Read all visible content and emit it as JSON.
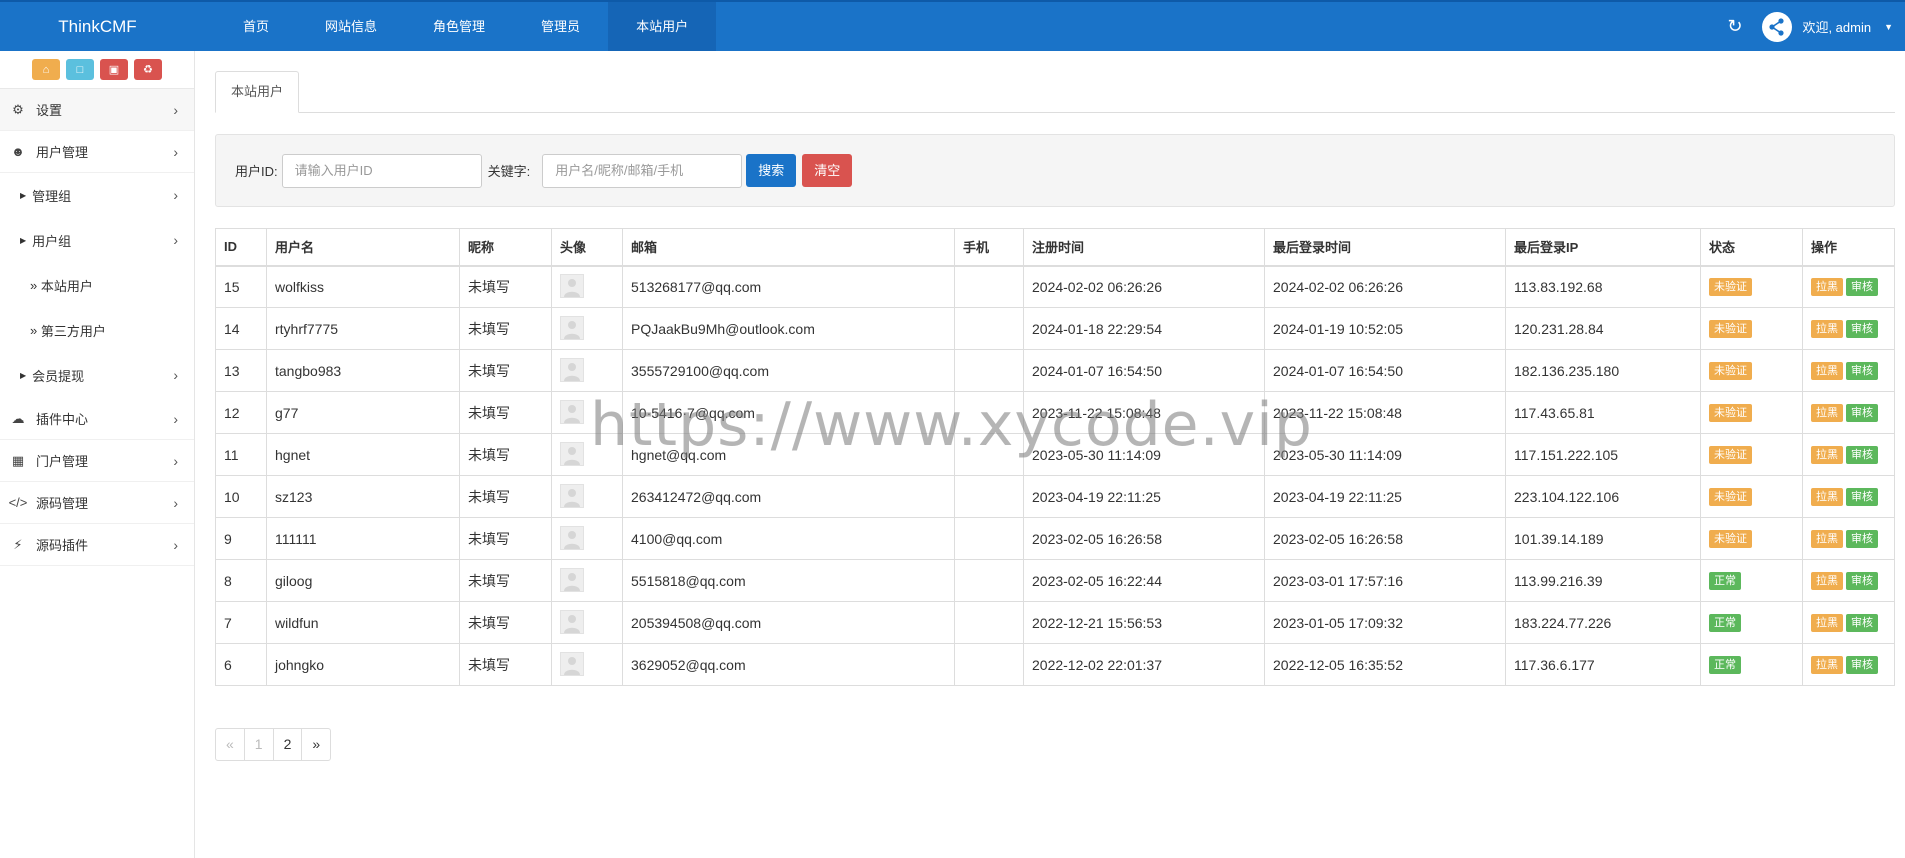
{
  "brand": "ThinkCMF",
  "nav": [
    "首页",
    "网站信息",
    "角色管理",
    "管理员",
    "本站用户"
  ],
  "user": {
    "welcome": "欢迎, admin"
  },
  "sidebar": {
    "items": [
      {
        "label": "设置"
      },
      {
        "label": "用户管理"
      },
      {
        "label": "管理组"
      },
      {
        "label": "用户组"
      },
      {
        "label": "本站用户"
      },
      {
        "label": "第三方用户"
      },
      {
        "label": "会员提现"
      },
      {
        "label": "插件中心"
      },
      {
        "label": "门户管理"
      },
      {
        "label": "源码管理"
      },
      {
        "label": "源码插件"
      }
    ]
  },
  "tab": "本站用户",
  "filter": {
    "uid_label": "用户ID:",
    "uid_placeholder": "请输入用户ID",
    "kw_label": "关键字:",
    "kw_placeholder": "用户名/昵称/邮箱/手机",
    "search": "搜索",
    "clear": "清空"
  },
  "table": {
    "headers": [
      "ID",
      "用户名",
      "昵称",
      "头像",
      "邮箱",
      "手机",
      "注册时间",
      "最后登录时间",
      "最后登录IP",
      "状态",
      "操作"
    ],
    "rows": [
      [
        "15",
        "wolfkiss",
        "未填写",
        "513268177@qq.com",
        "",
        "2024-02-02 06:26:26",
        "2024-02-02 06:26:26",
        "113.83.192.68",
        "未验证"
      ],
      [
        "14",
        "rtyhrf7775",
        "未填写",
        "PQJaakBu9Mh@outlook.com",
        "",
        "2024-01-18 22:29:54",
        "2024-01-19 10:52:05",
        "120.231.28.84",
        "未验证"
      ],
      [
        "13",
        "tangbo983",
        "未填写",
        "3555729100@qq.com",
        "",
        "2024-01-07 16:54:50",
        "2024-01-07 16:54:50",
        "182.136.235.180",
        "未验证"
      ],
      [
        "12",
        "g77",
        "未填写",
        "10·5416·7@qq.com",
        "",
        "2023-11-22 15:08:48",
        "2023-11-22 15:08:48",
        "117.43.65.81",
        "未验证"
      ],
      [
        "11",
        "hgnet",
        "未填写",
        "hgnet@qq.com",
        "",
        "2023-05-30 11:14:09",
        "2023-05-30 11:14:09",
        "117.151.222.105",
        "未验证"
      ],
      [
        "10",
        "sz123",
        "未填写",
        "263412472@qq.com",
        "",
        "2023-04-19 22:11:25",
        "2023-04-19 22:11:25",
        "223.104.122.106",
        "未验证"
      ],
      [
        "9",
        "111111",
        "未填写",
        "4100@qq.com",
        "",
        "2023-02-05 16:26:58",
        "2023-02-05 16:26:58",
        "101.39.14.189",
        "未验证"
      ],
      [
        "8",
        "giloog",
        "未填写",
        "5515818@qq.com",
        "",
        "2023-02-05 16:22:44",
        "2023-03-01 17:57:16",
        "113.99.216.39",
        "正常"
      ],
      [
        "7",
        "wildfun",
        "未填写",
        "205394508@qq.com",
        "",
        "2022-12-21 15:56:53",
        "2023-01-05 17:09:32",
        "183.224.77.226",
        "正常"
      ],
      [
        "6",
        "johngko",
        "未填写",
        "3629052@qq.com",
        "",
        "2022-12-02 22:01:37",
        "2022-12-05 16:35:52",
        "117.36.6.177",
        "正常"
      ]
    ],
    "ops": [
      "拉黑",
      "审核"
    ]
  },
  "pager": [
    "«",
    "1",
    "2",
    "»"
  ],
  "watermark": "https://www.xycode.vip"
}
